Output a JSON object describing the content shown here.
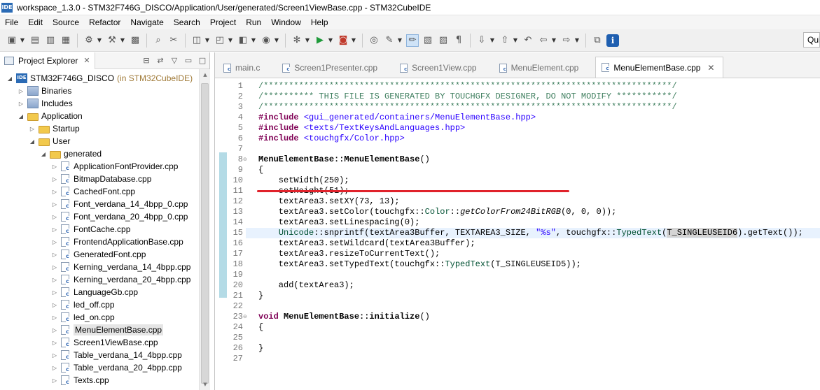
{
  "window": {
    "title": "workspace_1.3.0 - STM32F746G_DISCO/Application/User/generated/Screen1ViewBase.cpp - STM32CubeIDE",
    "app_icon_text": "IDE"
  },
  "menu": [
    "File",
    "Edit",
    "Source",
    "Refactor",
    "Navigate",
    "Search",
    "Project",
    "Run",
    "Window",
    "Help"
  ],
  "toolbar": {
    "quick_access": "Quick Access"
  },
  "explorer": {
    "tab_label": "Project Explorer",
    "items": [
      {
        "label": "STM32F746G_DISCO",
        "hint": "(in STM32CubeIDE)",
        "icon": "project-icon",
        "twisty": "expanded",
        "depth": 0
      },
      {
        "label": "Binaries",
        "icon": "binaries-icon",
        "twisty": "collapsed",
        "depth": 1
      },
      {
        "label": "Includes",
        "icon": "includes-icon",
        "twisty": "collapsed",
        "depth": 1
      },
      {
        "label": "Application",
        "icon": "folder-icon",
        "twisty": "expanded",
        "depth": 1
      },
      {
        "label": "Startup",
        "icon": "folder-icon",
        "twisty": "collapsed",
        "depth": 2
      },
      {
        "label": "User",
        "icon": "folder-icon",
        "twisty": "expanded",
        "depth": 2
      },
      {
        "label": "generated",
        "icon": "folder-icon",
        "twisty": "expanded",
        "depth": 3
      },
      {
        "label": "ApplicationFontProvider.cpp",
        "icon": "cpp-file-icon",
        "twisty": "collapsed",
        "depth": 4
      },
      {
        "label": "BitmapDatabase.cpp",
        "icon": "cpp-file-icon",
        "twisty": "collapsed",
        "depth": 4
      },
      {
        "label": "CachedFont.cpp",
        "icon": "cpp-file-icon",
        "twisty": "collapsed",
        "depth": 4
      },
      {
        "label": "Font_verdana_14_4bpp_0.cpp",
        "icon": "cpp-file-icon",
        "twisty": "collapsed",
        "depth": 4
      },
      {
        "label": "Font_verdana_20_4bpp_0.cpp",
        "icon": "cpp-file-icon",
        "twisty": "collapsed",
        "depth": 4
      },
      {
        "label": "FontCache.cpp",
        "icon": "cpp-file-icon",
        "twisty": "collapsed",
        "depth": 4
      },
      {
        "label": "FrontendApplicationBase.cpp",
        "icon": "cpp-file-icon",
        "twisty": "collapsed",
        "depth": 4
      },
      {
        "label": "GeneratedFont.cpp",
        "icon": "cpp-file-icon",
        "twisty": "collapsed",
        "depth": 4
      },
      {
        "label": "Kerning_verdana_14_4bpp.cpp",
        "icon": "cpp-file-icon",
        "twisty": "collapsed",
        "depth": 4
      },
      {
        "label": "Kerning_verdana_20_4bpp.cpp",
        "icon": "cpp-file-icon",
        "twisty": "collapsed",
        "depth": 4
      },
      {
        "label": "LanguageGb.cpp",
        "icon": "cpp-file-icon",
        "twisty": "collapsed",
        "depth": 4
      },
      {
        "label": "led_off.cpp",
        "icon": "cpp-file-icon",
        "twisty": "collapsed",
        "depth": 4
      },
      {
        "label": "led_on.cpp",
        "icon": "cpp-file-icon",
        "twisty": "collapsed",
        "depth": 4
      },
      {
        "label": "MenuElementBase.cpp",
        "icon": "cpp-file-icon",
        "twisty": "collapsed",
        "depth": 4,
        "selected": true
      },
      {
        "label": "Screen1ViewBase.cpp",
        "icon": "cpp-file-icon",
        "twisty": "collapsed",
        "depth": 4
      },
      {
        "label": "Table_verdana_14_4bpp.cpp",
        "icon": "cpp-file-icon",
        "twisty": "collapsed",
        "depth": 4
      },
      {
        "label": "Table_verdana_20_4bpp.cpp",
        "icon": "cpp-file-icon",
        "twisty": "collapsed",
        "depth": 4
      },
      {
        "label": "Texts.cpp",
        "icon": "cpp-file-icon",
        "twisty": "collapsed",
        "depth": 4
      }
    ]
  },
  "editor": {
    "tabs": [
      {
        "label": "main.c",
        "active": false
      },
      {
        "label": "Screen1Presenter.cpp",
        "active": false
      },
      {
        "label": "Screen1View.cpp",
        "active": false
      },
      {
        "label": "MenuElement.cpp",
        "active": false
      },
      {
        "label": "MenuElementBase.cpp",
        "active": true
      }
    ],
    "lines": [
      {
        "n": "1",
        "tokens": [
          [
            "cmt",
            "/*********************************************************************************/"
          ]
        ]
      },
      {
        "n": "2",
        "tokens": [
          [
            "cmt",
            "/********** THIS FILE IS GENERATED BY TOUCHGFX DESIGNER, DO NOT MODIFY ***********/"
          ]
        ]
      },
      {
        "n": "3",
        "tokens": [
          [
            "cmt",
            "/*********************************************************************************/"
          ]
        ]
      },
      {
        "n": "4",
        "tokens": [
          [
            "kw",
            "#include"
          ],
          [
            "txt",
            " "
          ],
          [
            "str",
            "<gui_generated/containers/MenuElementBase.hpp>"
          ]
        ]
      },
      {
        "n": "5",
        "tokens": [
          [
            "kw",
            "#include"
          ],
          [
            "txt",
            " "
          ],
          [
            "str",
            "<texts/TextKeysAndLanguages.hpp>"
          ]
        ]
      },
      {
        "n": "6",
        "tokens": [
          [
            "kw",
            "#include"
          ],
          [
            "txt",
            " "
          ],
          [
            "str",
            "<touchgfx/Color.hpp>"
          ]
        ]
      },
      {
        "n": "7",
        "tokens": []
      },
      {
        "n": "8",
        "fold": true,
        "tokens": [
          [
            "fn",
            "MenuElementBase::MenuElementBase"
          ],
          [
            "txt",
            "()"
          ]
        ]
      },
      {
        "n": "9",
        "tokens": [
          [
            "txt",
            "{"
          ]
        ]
      },
      {
        "n": "10",
        "tokens": [
          [
            "txt",
            "    setWidth(250);"
          ]
        ]
      },
      {
        "n": "11",
        "tokens": [
          [
            "txt",
            "    setHeight(51);"
          ]
        ]
      },
      {
        "n": "12",
        "tokens": [
          [
            "txt",
            "    textArea3.setXY(73, 13);"
          ]
        ]
      },
      {
        "n": "13",
        "tokens": [
          [
            "txt",
            "    textArea3.setColor(touchgfx::"
          ],
          [
            "cls",
            "Color"
          ],
          [
            "txt",
            "::"
          ],
          [
            "static",
            "getColorFrom24BitRGB"
          ],
          [
            "txt",
            "(0, 0, 0));"
          ]
        ]
      },
      {
        "n": "14",
        "tokens": [
          [
            "txt",
            "    textArea3.setLinespacing(0);"
          ]
        ]
      },
      {
        "n": "15",
        "highlight": true,
        "tokens": [
          [
            "txt",
            "    "
          ],
          [
            "cls",
            "Unicode"
          ],
          [
            "txt",
            "::snprintf(textArea3Buffer, TEXTAREA3_SIZE, "
          ],
          [
            "str",
            "\"%s\""
          ],
          [
            "txt",
            ", touchgfx::"
          ],
          [
            "cls",
            "TypedText"
          ],
          [
            "txt",
            "("
          ],
          [
            "mark",
            "T_SINGLEUSEID6"
          ],
          [
            "txt",
            ").getText());"
          ]
        ]
      },
      {
        "n": "16",
        "tokens": [
          [
            "txt",
            "    textArea3.setWildcard(textArea3Buffer);"
          ]
        ]
      },
      {
        "n": "17",
        "tokens": [
          [
            "txt",
            "    textArea3.resizeToCurrentText();"
          ]
        ]
      },
      {
        "n": "18",
        "tokens": [
          [
            "txt",
            "    textArea3.setTypedText(touchgfx::"
          ],
          [
            "cls",
            "TypedText"
          ],
          [
            "txt",
            "(T_SINGLEUSEID5));"
          ]
        ]
      },
      {
        "n": "19",
        "tokens": []
      },
      {
        "n": "20",
        "tokens": [
          [
            "txt",
            "    add(textArea3);"
          ]
        ]
      },
      {
        "n": "21",
        "tokens": [
          [
            "txt",
            "}"
          ]
        ]
      },
      {
        "n": "22",
        "tokens": []
      },
      {
        "n": "23",
        "fold": true,
        "tokens": [
          [
            "kw",
            "void"
          ],
          [
            "txt",
            " "
          ],
          [
            "fn",
            "MenuElementBase::initialize"
          ],
          [
            "txt",
            "()"
          ]
        ]
      },
      {
        "n": "24",
        "tokens": [
          [
            "txt",
            "{"
          ]
        ]
      },
      {
        "n": "25",
        "tokens": []
      },
      {
        "n": "26",
        "tokens": [
          [
            "txt",
            "}"
          ]
        ]
      },
      {
        "n": "27",
        "tokens": []
      }
    ]
  },
  "colors": {
    "keyword": "#7f0055",
    "comment": "#3f7f5f",
    "string": "#2a00ff",
    "annotation_line": "#e0222b",
    "current_line": "#e8f2fe"
  }
}
